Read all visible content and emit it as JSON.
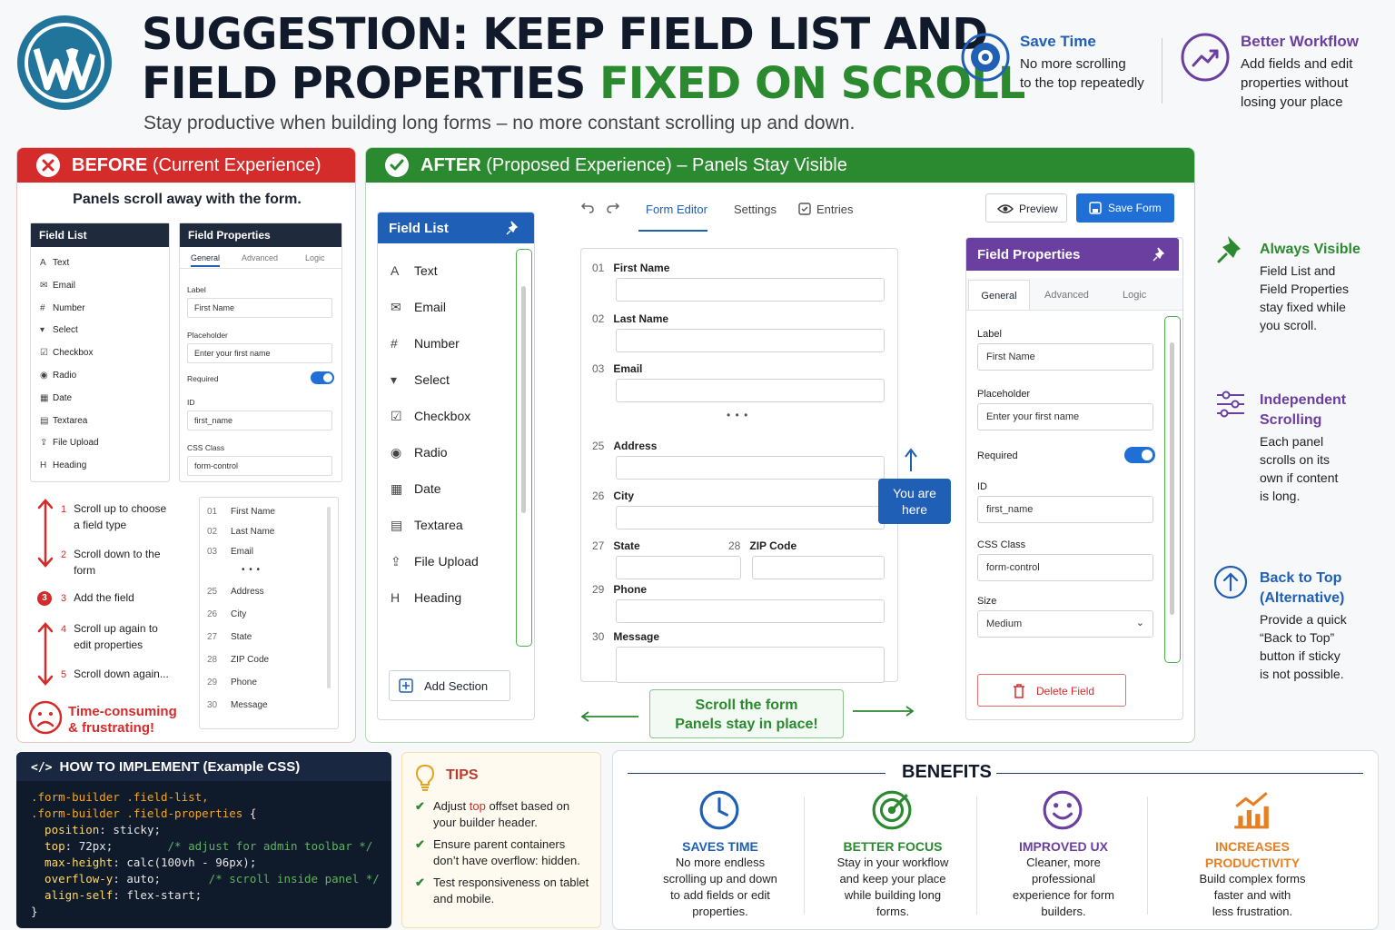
{
  "header": {
    "title_line1": "SUGGESTION: KEEP FIELD LIST AND",
    "title_line2_a": "FIELD PROPERTIES ",
    "title_line2_b": "FIXED ON SCROLL",
    "subtitle": "Stay productive when building long forms – no more constant scrolling up and down.",
    "badges": [
      {
        "title": "Save Time",
        "text": [
          "No more scrolling",
          "to the top repeatedly"
        ],
        "color": "#1f5fb6",
        "icon": "target-icon"
      },
      {
        "title": "Better Workflow",
        "text": [
          "Add fields and edit",
          "properties without",
          "losing your place"
        ],
        "color": "#6b3fa0",
        "icon": "trend-up-icon"
      }
    ]
  },
  "before": {
    "heading_bold": "BEFORE",
    "heading_rest": " (Current Experience)",
    "subheading": "Panels scroll away with the form.",
    "field_list_title": "Field List",
    "field_list": [
      {
        "label": "Text",
        "icon": "text-icon"
      },
      {
        "label": "Email",
        "icon": "email-icon"
      },
      {
        "label": "Number",
        "icon": "number-icon"
      },
      {
        "label": "Select",
        "icon": "select-icon"
      },
      {
        "label": "Checkbox",
        "icon": "checkbox-icon"
      },
      {
        "label": "Radio",
        "icon": "radio-icon"
      },
      {
        "label": "Date",
        "icon": "date-icon"
      },
      {
        "label": "Textarea",
        "icon": "textarea-icon"
      },
      {
        "label": "File Upload",
        "icon": "upload-icon"
      },
      {
        "label": "Heading",
        "icon": "heading-icon"
      }
    ],
    "props_title": "Field Properties",
    "props_tabs": [
      "General",
      "Advanced",
      "Logic"
    ],
    "props": {
      "label_label": "Label",
      "label_value": "First Name",
      "placeholder_label": "Placeholder",
      "placeholder_value": "Enter your first name",
      "required_label": "Required",
      "id_label": "ID",
      "id_value": "first_name",
      "css_label": "CSS Class",
      "css_value": "form-control"
    },
    "steps": [
      {
        "n": "1",
        "text": [
          "Scroll up to choose",
          "a field type"
        ]
      },
      {
        "n": "2",
        "text": [
          "Scroll down to the",
          "form"
        ]
      },
      {
        "n": "3",
        "text": [
          "Add the field"
        ]
      },
      {
        "n": "4",
        "text": [
          "Scroll up again to",
          "edit properties"
        ]
      },
      {
        "n": "5",
        "text": [
          "Scroll down again..."
        ]
      }
    ],
    "form_rows_top": [
      {
        "n": "01",
        "label": "First Name"
      },
      {
        "n": "02",
        "label": "Last Name"
      },
      {
        "n": "03",
        "label": "Email"
      }
    ],
    "ellipsis": "• • •",
    "form_rows_bottom": [
      {
        "n": "25",
        "label": "Address"
      },
      {
        "n": "26",
        "label": "City"
      },
      {
        "n": "27",
        "label": "State"
      },
      {
        "n": "28",
        "label": "ZIP Code"
      },
      {
        "n": "29",
        "label": "Phone"
      },
      {
        "n": "30",
        "label": "Message"
      }
    ],
    "frustration": [
      "Time-consuming",
      "& frustrating!"
    ]
  },
  "after": {
    "heading_bold": "AFTER",
    "heading_rest": " (Proposed Experience) – Panels Stay Visible",
    "toolbar": {
      "tabs": [
        "Form Editor",
        "Settings",
        "Entries"
      ],
      "active_tab": "Form Editor",
      "preview": "Preview",
      "save": "Save Form"
    },
    "field_list_title": "Field List",
    "field_list": [
      {
        "label": "Text",
        "icon": "text-icon"
      },
      {
        "label": "Email",
        "icon": "email-icon"
      },
      {
        "label": "Number",
        "icon": "number-icon"
      },
      {
        "label": "Select",
        "icon": "select-icon"
      },
      {
        "label": "Checkbox",
        "icon": "checkbox-icon"
      },
      {
        "label": "Radio",
        "icon": "radio-icon"
      },
      {
        "label": "Date",
        "icon": "date-icon"
      },
      {
        "label": "Textarea",
        "icon": "textarea-icon"
      },
      {
        "label": "File Upload",
        "icon": "upload-icon"
      },
      {
        "label": "Heading",
        "icon": "heading-icon"
      }
    ],
    "add_section": "Add Section",
    "form_fields": [
      {
        "n": "01",
        "label": "First Name"
      },
      {
        "n": "02",
        "label": "Last Name"
      },
      {
        "n": "03",
        "label": "Email"
      },
      {
        "n": "25",
        "label": "Address"
      },
      {
        "n": "26",
        "label": "City"
      },
      {
        "n": "27",
        "label": "State"
      },
      {
        "n": "28",
        "label": "ZIP Code"
      },
      {
        "n": "29",
        "label": "Phone"
      },
      {
        "n": "30",
        "label": "Message"
      }
    ],
    "ellipsis": "• • •",
    "you_are_here": [
      "You are",
      "here"
    ],
    "scroll_note": [
      "Scroll the form",
      "Panels stay in place!"
    ],
    "props_title": "Field Properties",
    "props_tabs": [
      "General",
      "Advanced",
      "Logic"
    ],
    "props": {
      "label_label": "Label",
      "label_value": "First Name",
      "placeholder_label": "Placeholder",
      "placeholder_value": "Enter your first name",
      "required_label": "Required",
      "id_label": "ID",
      "id_value": "first_name",
      "css_label": "CSS Class",
      "css_value": "form-control",
      "size_label": "Size",
      "size_value": "Medium"
    },
    "delete": "Delete Field"
  },
  "features": [
    {
      "title": [
        "Always Visible"
      ],
      "text": [
        "Field List and",
        "Field Properties",
        "stay fixed while",
        "you scroll."
      ],
      "color": "#2b8a2f",
      "icon": "pin-icon"
    },
    {
      "title": [
        "Independent",
        "Scrolling"
      ],
      "text": [
        "Each panel",
        "scrolls on its",
        "own if content",
        "is long."
      ],
      "color": "#6b3fa0",
      "icon": "sliders-icon"
    },
    {
      "title": [
        "Back to Top",
        "(Alternative)"
      ],
      "text": [
        "Provide a quick",
        "“Back to Top”",
        "button if sticky",
        "is not possible."
      ],
      "color": "#1f5fb6",
      "icon": "arrow-up-circle-icon"
    }
  ],
  "code": {
    "title": "HOW TO IMPLEMENT (Example CSS)",
    "lines": [
      [
        {
          "t": ".form-builder .field-list,",
          "c": "c-sel"
        }
      ],
      [
        {
          "t": ".form-builder .field-properties ",
          "c": "c-sel"
        },
        {
          "t": "{",
          "c": ""
        }
      ],
      [
        {
          "t": "  position",
          "c": "c-prop"
        },
        {
          "t": ": sticky;",
          "c": ""
        }
      ],
      [
        {
          "t": "  top",
          "c": "c-prop"
        },
        {
          "t": ": 72px;        ",
          "c": ""
        },
        {
          "t": "/* adjust for admin toolbar */",
          "c": "c-cmt"
        }
      ],
      [
        {
          "t": "  max-height",
          "c": "c-prop"
        },
        {
          "t": ": calc(100vh - 96px);",
          "c": ""
        }
      ],
      [
        {
          "t": "  overflow-y",
          "c": "c-prop"
        },
        {
          "t": ": auto;       ",
          "c": ""
        },
        {
          "t": "/* scroll inside panel */",
          "c": "c-cmt"
        }
      ],
      [
        {
          "t": "  align-self",
          "c": "c-prop"
        },
        {
          "t": ": flex-start;",
          "c": ""
        }
      ],
      [
        {
          "t": "}",
          "c": ""
        }
      ]
    ]
  },
  "tips": {
    "title": "TIPS",
    "items": [
      [
        "Adjust ",
        "top",
        " offset based on your builder header."
      ],
      [
        "Ensure parent containers don’t have overflow: hidden."
      ],
      [
        "Test responsiveness on tablet and mobile."
      ]
    ]
  },
  "benefits": {
    "title": "BENEFITS",
    "items": [
      {
        "title": [
          "SAVES TIME"
        ],
        "text": [
          "No more endless",
          "scrolling up and down",
          "to add fields or edit",
          "properties."
        ],
        "color": "#1f5fb6",
        "icon": "clock-icon"
      },
      {
        "title": [
          "BETTER FOCUS"
        ],
        "text": [
          "Stay in your workflow",
          "and keep your place",
          "while building long",
          "forms."
        ],
        "color": "#2b8a2f",
        "icon": "bullseye-icon"
      },
      {
        "title": [
          "IMPROVED UX"
        ],
        "text": [
          "Cleaner, more",
          "professional",
          "experience for form",
          "builders."
        ],
        "color": "#6b3fa0",
        "icon": "smile-icon"
      },
      {
        "title": [
          "INCREASES",
          "PRODUCTIVITY"
        ],
        "text": [
          "Build complex forms",
          "faster and with",
          "less frustration."
        ],
        "color": "#e67e22",
        "icon": "growth-chart-icon"
      }
    ]
  }
}
